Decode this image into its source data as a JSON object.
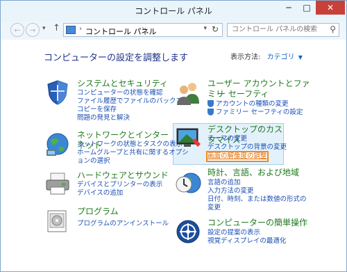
{
  "window": {
    "title": "コントロール パネル",
    "controls": {
      "minimize": "─",
      "maximize": "□",
      "close": "✕"
    }
  },
  "nav": {
    "back": "←",
    "forward": "→",
    "up": "↑",
    "breadcrumb": "コントロール パネル",
    "search_placeholder": "コントロール パネルの検索"
  },
  "main": {
    "heading": "コンピューターの設定を調整します",
    "view_by_label": "表示方法:",
    "view_by_value": "カテゴリ"
  },
  "categories": [
    {
      "title": "システムとセキュリティ",
      "icon": "shield-icon",
      "links": [
        "コンピューターの状態を確認",
        "ファイル履歴でファイルのバックアップ",
        "コピーを保存",
        "問題の発見と解決"
      ]
    },
    {
      "title": "ネットワークとインターネット",
      "icon": "network-globe-icon",
      "links": [
        "ネットワークの状態とタスクの表示",
        "ホームグループと共有に関するオプシ",
        "ョンの選択"
      ]
    },
    {
      "title": "ハードウェアとサウンド",
      "icon": "printer-icon",
      "links": [
        "デバイスとプリンターの表示",
        "デバイスの追加"
      ]
    },
    {
      "title": "プログラム",
      "icon": "programs-icon",
      "links": [
        "プログラムのアンインストール"
      ]
    },
    {
      "title": "ユーザー アカウントとファミリ",
      "title2": "ー セーフティ",
      "icon": "users-icon",
      "links": [
        "アカウントの種類の変更",
        "ファミリー セーフティの設定"
      ]
    },
    {
      "title": "デスクトップのカスタマイズ",
      "icon": "monitor-icon",
      "links": [
        "テーマの変更",
        "デスクトップの背景の変更",
        "画面の解像度の調整"
      ]
    },
    {
      "title": "時計、言語、および地域",
      "icon": "clock-globe-icon",
      "links": [
        "言語の追加",
        "入力方法の変更",
        "日付、時刻、または数値の形式の",
        "変更"
      ]
    },
    {
      "title": "コンピューターの簡単操作",
      "icon": "ease-of-access-icon",
      "links": [
        "設定の提案の表示",
        "視覚ディスプレイの最適化"
      ]
    }
  ],
  "colors": {
    "category_title": "#1e7a1e",
    "link": "#1a4fb5",
    "heading": "#1e3287",
    "highlight_border": "#f08a1a",
    "close_button": "#c7413a"
  }
}
